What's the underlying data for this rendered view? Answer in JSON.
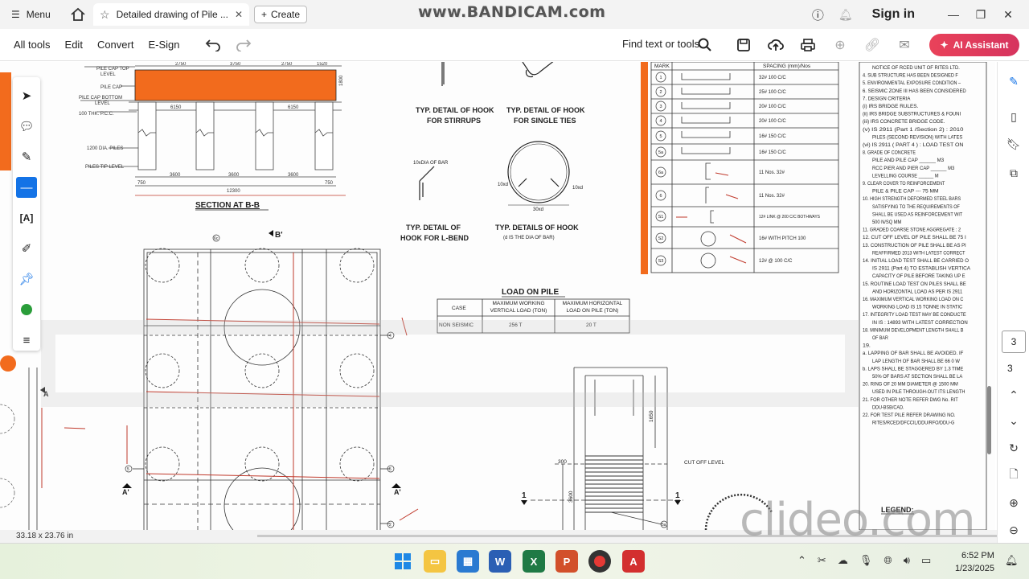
{
  "browser": {
    "menu_label": "Menu",
    "tab_title": "Detailed drawing of Pile ...",
    "create_label": "Create",
    "sign_in": "Sign in",
    "watermark": "www.BANDICAM.com"
  },
  "toolbar": {
    "all_tools": "All tools",
    "edit": "Edit",
    "convert": "Convert",
    "esign": "E-Sign",
    "find": "Find text or tools",
    "ai_assistant": "AI Assistant"
  },
  "drawing": {
    "section_title": "SECTION AT B-B",
    "pile_cap_top": "PILE CAP TOP",
    "level": "LEVEL",
    "pile_cap": "PILE CAP",
    "pile_cap_bottom": "PILE CAP BOTTOM",
    "pcc": "100 THK. P.C.C.",
    "dia_piles": "1200 DIA. PILES",
    "piles_tip": "PILES TIP LEVEL",
    "dims_top": [
      "2750",
      "3750",
      "2750",
      "1520"
    ],
    "dims_mid": [
      "6150",
      "6150"
    ],
    "dims_bot": [
      "3600",
      "3600",
      "3600"
    ],
    "total_width": "12300",
    "cap_depth": "1800",
    "edge_dims": [
      "750",
      "750"
    ],
    "hook_stirrups": [
      "TYP. DETAIL OF HOOK",
      "FOR STIRRUPS"
    ],
    "hook_ties": [
      "TYP. DETAIL OF HOOK",
      "FOR SINGLE TIES"
    ],
    "hook_lbend": [
      "TYP. DETAIL OF",
      "HOOK FOR L-BEND"
    ],
    "hook_details": [
      "TYP. DETAILS OF HOOK",
      "(d IS THE DIA OF BAR)"
    ],
    "dia_of_bar": "10xDIA OF BAR",
    "hook_30d": "30xd",
    "hook_10d": "10xd",
    "load_title": "LOAD ON PILE",
    "load_table": {
      "headers": [
        "CASE",
        "MAXIMUM WORKING VERTICAL LOAD (TON)",
        "MAXIMUM HORIZONTAL LOAD ON PILE (TON)"
      ],
      "row": [
        "NON SEISMIC",
        "256 T",
        "20 T"
      ]
    },
    "section_b_mark": "B'",
    "section_a_mark": "A'",
    "spacing_header": "SPACING (mm)/Nos",
    "mark_header": "MARK",
    "bar_marks": [
      "1",
      "2",
      "3",
      "4",
      "5",
      "5a",
      "6a",
      "6",
      "S1",
      "S2",
      "S3"
    ],
    "bar_spacing": [
      "32# 100 C/C",
      "25# 100 C/C",
      "20# 100 C/C",
      "20# 100 C/C",
      "16# 150 C/C",
      "16# 150 C/C",
      "11 Nos. 32#",
      "11 Nos. 32#",
      "12# LINK @ 200 C/C BOTHWAYS",
      "16# WITH PITCH 100",
      "12# @ 100 C/C"
    ],
    "cut_off": "CUT OFF LEVEL",
    "dim_1650": "1650",
    "dim_300": "300",
    "dim_3600": "3600",
    "section_one": "1",
    "legend": "LEGEND:",
    "notes": [
      "NOTICE OF RCED UNIT OF RITES LTD.",
      "4. SUB STRUCTURE HAS BEEN DESIGNED F",
      "5. ENVIRONMENTAL EXPOSURE CONDITION –",
      "6. SEISMIC ZONE III HAS BEEN CONSIDERED",
      "7. DESIGN CRITERIA",
      "(i) IRS BRIDGE RULES.",
      "(ii) IRS BRIDGE SUBSTRUCTURES & FOUNI",
      "(iii) IRS CONCRETE BRIDGE CODE.",
      "(v) IS 2911 (Part 1 /Section 2) : 2010",
      "PILES (SECOND REVISION) WITH LATES",
      "(vi) IS 2911 ( PART 4 ) : LOAD TEST ON",
      "8. GRADE OF CONCRETE",
      "PILE AND PILE CAP ______ M3",
      "RCC PIER AND PIER CAP ______ M3",
      "LEVELLING COURSE ______ M",
      "9. CLEAR COVER TO REINFORCEMENT",
      "PILE & PILE CAP --- 75 MM",
      "10. HIGH STRENGTH DEFORMED STEEL BARS",
      "SATISFYING TO THE REQUIREMENTS OF",
      "SHALL BE USED AS REINFORCEMENT WIT",
      "500 N/SQ MM",
      "11. GRADED COARSE STONE AGGREGATE : 2",
      "12. CUT OFF LEVEL OF PILE SHALL BE 75 I",
      "13. CONSTRUCTION OF PILE SHALL BE AS PI",
      "REAFFIRMED 2013 WITH LATEST CORRECT",
      "14. INITIAL LOAD TEST SHALL BE CARRIED O",
      "IS 2911 (Part 4) TO ESTABLISH VERTICA",
      "CAPACITY OF PILE BEFORE TAKING UP E",
      "15. ROUTINE LOAD TEST ON PILES SHALL BE",
      "AND HORIZONTAL LOAD AS PER IS 2911",
      "16. MAXIMUM VERTICAL WORKING LOAD ON C",
      "WORKING LOAD IS 15 TONNE IN STATIC",
      "17. INTEGRITY LOAD TEST MAY BE CONDUCTE",
      "IN IS : 14893 WITH LATEST CORRECTION",
      "18. MINIMUM DEVELOPMENT LENGTH SHALL B",
      "OF BAR",
      "19.",
      "a. LAPPING OF BAR SHALL BE AVOIDED. IF",
      "LAP LENGTH OF BAR SHALL BE 66 0 W",
      "b. LAPS SHALL BE STAGGERED BY 1.3 TIME",
      "50% OF BARS AT SECTION SHALL BE LA",
      "20. RING OF 20 MM DIAMETER @ 1500 MM",
      "USED IN PILE THROUGH-OUT ITS LENGTH",
      "21. FOR OTHER NOTE REFER DWG No. RIT",
      "DDU-BSB/CAD.",
      "22. FOR TEST PILE REFER DRAWING NO.",
      "RITES/RCED/DFCCIL/DDU/RFO/DDU-G"
    ]
  },
  "status": {
    "doc_size": "33.18 x 23.76 in"
  },
  "right_rail": {
    "page_current": "3",
    "page_total": "3"
  },
  "taskbar": {
    "time": "6:52 PM",
    "date": "1/23/2025",
    "apps": [
      "windows",
      "file-explorer",
      "store",
      "word",
      "excel",
      "powerpoint",
      "recorder",
      "acrobat"
    ]
  },
  "watermark_bottom": "clideo.com",
  "colors": {
    "accent": "#f26b1d",
    "ai_button": "#e23c5a",
    "selection": "#1473e6",
    "red_lines": "#c0392b"
  }
}
